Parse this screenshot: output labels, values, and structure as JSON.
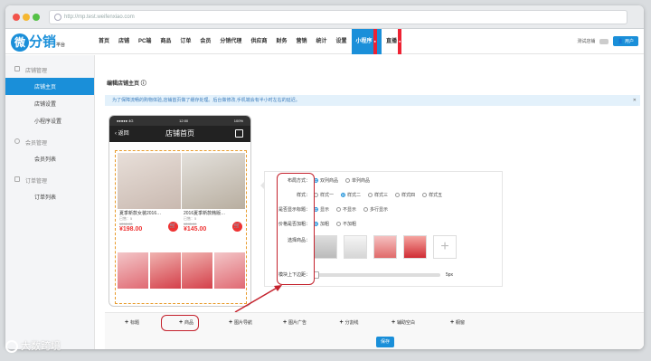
{
  "browser": {
    "url": "http://mp.test.weifenxiao.com"
  },
  "nav": {
    "logo": "微分销",
    "logo_sub": "平台",
    "menu": [
      "首页",
      "店铺",
      "PC端",
      "商品",
      "订单",
      "会员",
      "分销代理",
      "供应商",
      "财务",
      "营销",
      "统计",
      "设置",
      "小程序",
      "直播"
    ],
    "active": "小程序",
    "store_label": "测试店铺",
    "user_label": "用户"
  },
  "sidebar": {
    "groups": [
      {
        "title": "店铺管理",
        "items": [
          "店铺主页",
          "店铺设置",
          "小程序设置"
        ]
      },
      {
        "title": "会员管理",
        "items": [
          "会员列表"
        ]
      },
      {
        "title": "订单管理",
        "items": [
          "订单列表"
        ]
      }
    ]
  },
  "main": {
    "title": "编辑店铺主页",
    "notice": "为了保障流畅的购物体验,店铺首页做了缓存处理。后台做修改,手机端会有半小时左右的延迟。",
    "phone": {
      "carrier": "●●●●● 4G",
      "time": "12:00",
      "battery": "100%",
      "back": "返回",
      "header": "店铺首页",
      "products": [
        {
          "name": "夏季新款女装2016…",
          "sub": "已售：5",
          "old": "¥298.00",
          "price": "¥198.00"
        },
        {
          "name": "2016夏季新款韩版…",
          "sub": "已售：5",
          "old": "¥245.00",
          "price": "¥145.00"
        }
      ]
    },
    "settings": {
      "layout_label": "布局方式：",
      "layout_opts": [
        "双列商品",
        "单列商品"
      ],
      "style_label": "样式：",
      "style_opts": [
        "样式一",
        "样式二",
        "样式三",
        "样式四",
        "样式五"
      ],
      "showtitle_label": "是否显示标题：",
      "showtitle_opts": [
        "显示",
        "不显示",
        "多行显示"
      ],
      "bold_label": "价格是否加粗：",
      "bold_opts": [
        "加粗",
        "不加粗"
      ],
      "goods_label": "选择商品：",
      "margin_label": "模块上下边距：",
      "margin_value": "5px"
    },
    "tools": [
      "标题",
      "商品",
      "图片导航",
      "图片广告",
      "分割线",
      "辅助空白",
      "橱窗"
    ],
    "save": "保存"
  },
  "watermark": "大数跨境",
  "colors": {
    "accent": "#1a8fd9",
    "highlight": "#c4212c",
    "price": "#e33333"
  }
}
